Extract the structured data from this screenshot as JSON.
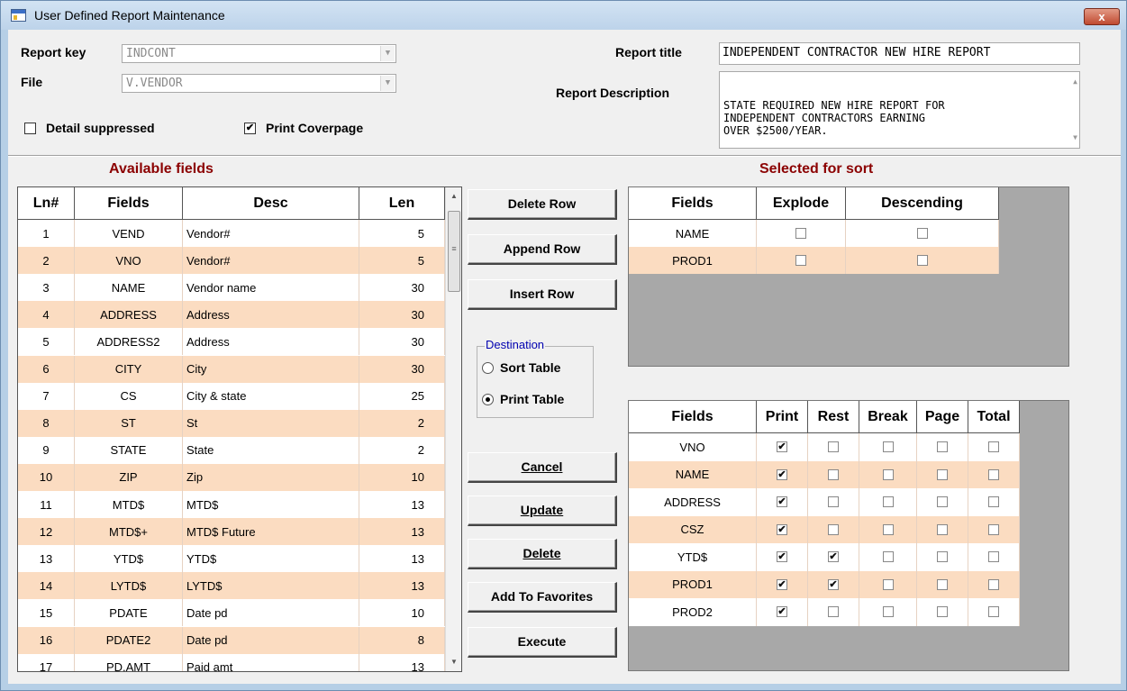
{
  "window": {
    "title": "User Defined Report Maintenance",
    "close_glyph": "x"
  },
  "header": {
    "report_key_label": "Report key",
    "report_key_value": "INDCONT",
    "file_label": "File",
    "file_value": "V.VENDOR",
    "report_title_label": "Report title",
    "report_title_value": "INDEPENDENT CONTRACTOR NEW HIRE REPORT",
    "report_description_label": "Report Description",
    "report_description_value": "STATE REQUIRED NEW HIRE REPORT FOR\nINDEPENDENT CONTRACTORS EARNING\nOVER $2500/YEAR.",
    "detail_suppressed_label": "Detail suppressed",
    "detail_suppressed_checked": false,
    "print_coverpage_label": "Print Coverpage",
    "print_coverpage_checked": true
  },
  "available_fields": {
    "title": "Available fields",
    "columns": [
      "Ln#",
      "Fields",
      "Desc",
      "Len"
    ],
    "rows": [
      {
        "ln": "1",
        "field": "VEND",
        "desc": "Vendor#",
        "len": "5"
      },
      {
        "ln": "2",
        "field": "VNO",
        "desc": "Vendor#",
        "len": "5"
      },
      {
        "ln": "3",
        "field": "NAME",
        "desc": "Vendor name",
        "len": "30"
      },
      {
        "ln": "4",
        "field": "ADDRESS",
        "desc": "Address",
        "len": "30"
      },
      {
        "ln": "5",
        "field": "ADDRESS2",
        "desc": "Address",
        "len": "30"
      },
      {
        "ln": "6",
        "field": "CITY",
        "desc": "City",
        "len": "30"
      },
      {
        "ln": "7",
        "field": "CS",
        "desc": "City & state",
        "len": "25"
      },
      {
        "ln": "8",
        "field": "ST",
        "desc": "St",
        "len": "2"
      },
      {
        "ln": "9",
        "field": "STATE",
        "desc": "State",
        "len": "2"
      },
      {
        "ln": "10",
        "field": "ZIP",
        "desc": "Zip",
        "len": "10"
      },
      {
        "ln": "11",
        "field": "MTD$",
        "desc": "MTD$",
        "len": "13"
      },
      {
        "ln": "12",
        "field": "MTD$+",
        "desc": "MTD$ Future",
        "len": "13"
      },
      {
        "ln": "13",
        "field": "YTD$",
        "desc": "YTD$",
        "len": "13"
      },
      {
        "ln": "14",
        "field": "LYTD$",
        "desc": "LYTD$",
        "len": "13"
      },
      {
        "ln": "15",
        "field": "PDATE",
        "desc": "Date pd",
        "len": "10"
      },
      {
        "ln": "16",
        "field": "PDATE2",
        "desc": "Date pd",
        "len": "8"
      },
      {
        "ln": "17",
        "field": "PD.AMT",
        "desc": "Paid amt",
        "len": "13"
      }
    ]
  },
  "buttons": {
    "delete_row": "Delete Row",
    "append_row": "Append Row",
    "insert_row": "Insert Row",
    "cancel": "Cancel",
    "update": "Update",
    "delete": "Delete",
    "add_to_favorites": "Add To Favorites",
    "execute": "Execute"
  },
  "destination": {
    "legend": "Destination",
    "sort_table_label": "Sort Table",
    "print_table_label": "Print Table",
    "selected": "Print Table"
  },
  "sort_table": {
    "title": "Selected for sort",
    "columns": [
      "Fields",
      "Explode",
      "Descending"
    ],
    "rows": [
      {
        "field": "NAME",
        "explode": false,
        "descending": false
      },
      {
        "field": "PROD1",
        "explode": false,
        "descending": false
      }
    ]
  },
  "print_table": {
    "columns": [
      "Fields",
      "Print",
      "Rest",
      "Break",
      "Page",
      "Total"
    ],
    "rows": [
      {
        "field": "VNO",
        "print": true,
        "rest": false,
        "break": false,
        "page": false,
        "total": false
      },
      {
        "field": "NAME",
        "print": true,
        "rest": false,
        "break": false,
        "page": false,
        "total": false
      },
      {
        "field": "ADDRESS",
        "print": true,
        "rest": false,
        "break": false,
        "page": false,
        "total": false
      },
      {
        "field": "CSZ",
        "print": true,
        "rest": false,
        "break": false,
        "page": false,
        "total": false
      },
      {
        "field": "YTD$",
        "print": true,
        "rest": true,
        "break": false,
        "page": false,
        "total": false
      },
      {
        "field": "PROD1",
        "print": true,
        "rest": true,
        "break": false,
        "page": false,
        "total": false
      },
      {
        "field": "PROD2",
        "print": true,
        "rest": false,
        "break": false,
        "page": false,
        "total": false
      }
    ]
  },
  "colors": {
    "row_alt": "#fbdcc1",
    "section_title": "#8b0000",
    "grid_empty": "#a8a8a8"
  }
}
